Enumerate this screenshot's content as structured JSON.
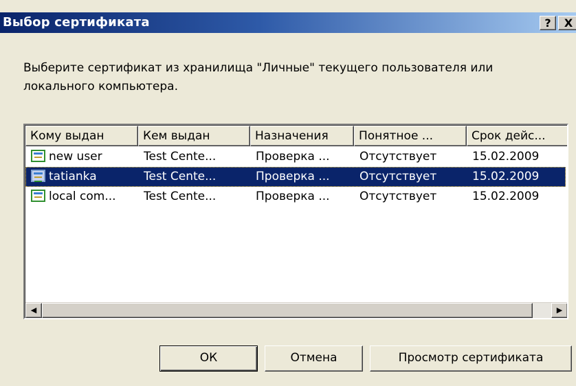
{
  "window": {
    "title": "Выбор сертификата",
    "help_glyph": "?",
    "close_glyph": "X"
  },
  "instruction": "Выберите сертификат из хранилища \"Личные\" текущего пользователя или локального компьютера.",
  "table": {
    "columns": [
      "Кому выдан",
      "Кем выдан",
      "Назначения",
      "Понятное ...",
      "Срок дейс..."
    ],
    "rows": [
      {
        "issued_to": "new user",
        "issued_by": "Test Cente...",
        "purposes": "Проверка ...",
        "friendly_name": "Отсутствует",
        "expires": "15.02.2009",
        "selected": false
      },
      {
        "issued_to": "tatianka",
        "issued_by": "Test Cente...",
        "purposes": "Проверка ...",
        "friendly_name": "Отсутствует",
        "expires": "15.02.2009",
        "selected": true
      },
      {
        "issued_to": "local com...",
        "issued_by": "Test Cente...",
        "purposes": "Проверка ...",
        "friendly_name": "Отсутствует",
        "expires": "15.02.2009",
        "selected": false
      }
    ],
    "row_icon": "certificate-icon"
  },
  "scrollbar": {
    "left_arrow": "◀",
    "right_arrow": "▶"
  },
  "buttons": {
    "ok": "ОК",
    "cancel": "Отмена",
    "view_certificate": "Просмотр сертификата"
  },
  "colors": {
    "title_gradient_start": "#0a246a",
    "selection": "#0a246a",
    "dialog_bg": "#ece9d8"
  }
}
